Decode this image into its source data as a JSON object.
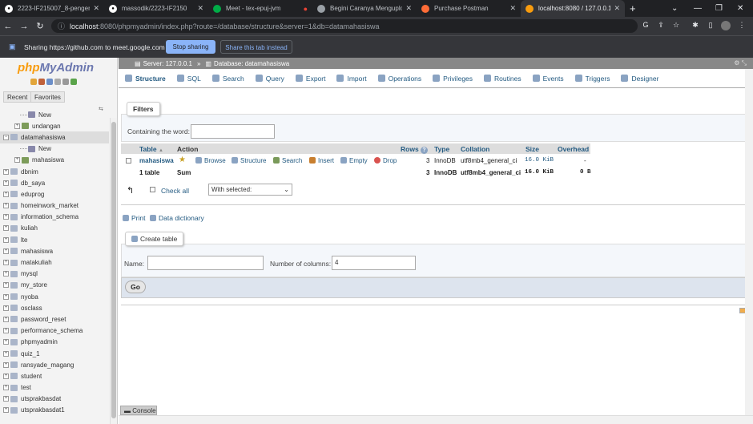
{
  "browser": {
    "tabs": [
      {
        "title": "2223-IF215007_8-pengeml",
        "icon": "github-icon",
        "color": "#ffffff"
      },
      {
        "title": "massodik/2223-IF2150",
        "icon": "github-icon",
        "color": "#ffffff"
      },
      {
        "title": "Meet - tex-epuj-jvm",
        "icon": "google-meet-icon",
        "color": "#00ac47"
      },
      {
        "title": "Begini Caranya Menguploa",
        "icon": "globe-icon",
        "color": "#9aa0a6"
      },
      {
        "title": "Purchase Postman",
        "icon": "postman-icon",
        "color": "#ff6c37"
      },
      {
        "title": "localhost:8080 / 127.0.0.1 /",
        "icon": "phpmyadmin-icon",
        "color": "#f89c0e"
      }
    ],
    "url_host": "localhost",
    "url_path": ":8080/phpmyadmin/index.php?route=/database/structure&server=1&db=datamahasiswa",
    "share_message": "Sharing https://github.com to meet.google.com",
    "stop_sharing": "Stop sharing",
    "share_this_tab": "Share this tab instead"
  },
  "sidebar": {
    "logo_php": "php",
    "logo_myadmin": "MyAdmin",
    "tab_recent": "Recent",
    "tab_favorites": "Favorites",
    "tree": [
      {
        "label": "New",
        "level": 2,
        "kind": "new"
      },
      {
        "label": "undangan",
        "level": 1,
        "kind": "table"
      },
      {
        "label": "datamahasiswa",
        "level": 0,
        "kind": "db",
        "selected": true
      },
      {
        "label": "New",
        "level": 2,
        "kind": "new"
      },
      {
        "label": "mahasiswa",
        "level": 1,
        "kind": "table",
        "selected": true
      },
      {
        "label": "dbnim",
        "level": 0,
        "kind": "db"
      },
      {
        "label": "db_saya",
        "level": 0,
        "kind": "db"
      },
      {
        "label": "eduprog",
        "level": 0,
        "kind": "db"
      },
      {
        "label": "homeinwork_market",
        "level": 0,
        "kind": "db"
      },
      {
        "label": "information_schema",
        "level": 0,
        "kind": "db"
      },
      {
        "label": "kuliah",
        "level": 0,
        "kind": "db"
      },
      {
        "label": "lte",
        "level": 0,
        "kind": "db"
      },
      {
        "label": "mahasiswa",
        "level": 0,
        "kind": "db"
      },
      {
        "label": "matakuliah",
        "level": 0,
        "kind": "db"
      },
      {
        "label": "mysql",
        "level": 0,
        "kind": "db"
      },
      {
        "label": "my_store",
        "level": 0,
        "kind": "db"
      },
      {
        "label": "nyoba",
        "level": 0,
        "kind": "db"
      },
      {
        "label": "osclass",
        "level": 0,
        "kind": "db"
      },
      {
        "label": "password_reset",
        "level": 0,
        "kind": "db"
      },
      {
        "label": "performance_schema",
        "level": 0,
        "kind": "db"
      },
      {
        "label": "phpmyadmin",
        "level": 0,
        "kind": "db"
      },
      {
        "label": "quiz_1",
        "level": 0,
        "kind": "db"
      },
      {
        "label": "ransyade_magang",
        "level": 0,
        "kind": "db"
      },
      {
        "label": "student",
        "level": 0,
        "kind": "db"
      },
      {
        "label": "test",
        "level": 0,
        "kind": "db"
      },
      {
        "label": "utsprakbasdat",
        "level": 0,
        "kind": "db"
      },
      {
        "label": "utsprakbasdat1",
        "level": 0,
        "kind": "db"
      }
    ]
  },
  "breadcrumb": {
    "server": "Server: 127.0.0.1",
    "sep": "»",
    "database": "Database: datamahasiswa"
  },
  "tabs": [
    {
      "label": "Structure",
      "icon": "structure-icon",
      "active": true
    },
    {
      "label": "SQL",
      "icon": "sql-icon"
    },
    {
      "label": "Search",
      "icon": "search-icon"
    },
    {
      "label": "Query",
      "icon": "query-icon"
    },
    {
      "label": "Export",
      "icon": "export-icon"
    },
    {
      "label": "Import",
      "icon": "import-icon"
    },
    {
      "label": "Operations",
      "icon": "operations-icon"
    },
    {
      "label": "Privileges",
      "icon": "privileges-icon"
    },
    {
      "label": "Routines",
      "icon": "routines-icon"
    },
    {
      "label": "Events",
      "icon": "events-icon"
    },
    {
      "label": "Triggers",
      "icon": "triggers-icon"
    },
    {
      "label": "Designer",
      "icon": "designer-icon"
    }
  ],
  "filters": {
    "legend": "Filters",
    "label": "Containing the word:",
    "value": ""
  },
  "table": {
    "headers": {
      "table": "Table",
      "sort": "▲",
      "action": "Action",
      "rows": "Rows",
      "help": "?",
      "type": "Type",
      "collation": "Collation",
      "size": "Size",
      "overhead": "Overhead"
    },
    "rows": [
      {
        "name": "mahasiswa",
        "actions": [
          "Browse",
          "Structure",
          "Search",
          "Insert",
          "Empty",
          "Drop"
        ],
        "rows": "3",
        "type": "InnoDB",
        "collation": "utf8mb4_general_ci",
        "size": "16.0 KiB",
        "overhead": "-"
      }
    ],
    "summary": {
      "name": "1 table",
      "sum": "Sum",
      "rows": "3",
      "type": "InnoDB",
      "collation": "utf8mb4_general_ci",
      "size": "16.0 KiB",
      "overhead": "0 B"
    },
    "check_all": "Check all",
    "with_selected": "With selected:"
  },
  "links": {
    "print": "Print",
    "data_dictionary": "Data dictionary"
  },
  "create_table": {
    "legend": "Create table",
    "name_label": "Name:",
    "name_value": "",
    "columns_label": "Number of columns:",
    "columns_value": "4",
    "go": "Go"
  },
  "console": "Console"
}
